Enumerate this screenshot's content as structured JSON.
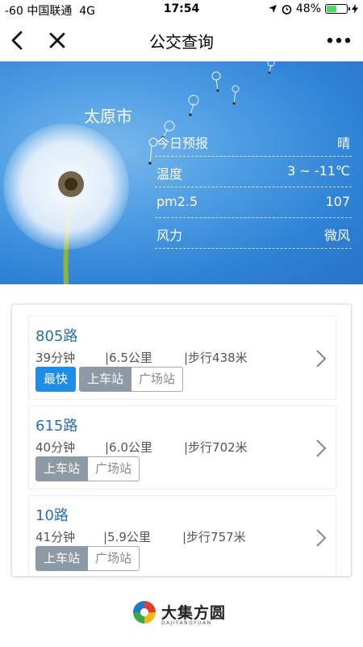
{
  "status_bar": {
    "carrier": "-60 中国联通",
    "network": "4G",
    "time": "17:54",
    "battery_text": "48%",
    "battery_level": 0.48
  },
  "nav": {
    "title": "公交查询",
    "back_icon": "chevron-left-icon",
    "close_icon": "close-icon",
    "more_icon": "more-dots-icon"
  },
  "weather": {
    "city": "太原市",
    "rows": [
      {
        "key": "今日预报",
        "value": "晴"
      },
      {
        "key": "温度",
        "value": "3 ~ -11℃"
      },
      {
        "key": "pm2.5",
        "value": "107"
      },
      {
        "key": "风力",
        "value": "微风"
      }
    ]
  },
  "routes": [
    {
      "name": "805路",
      "duration": "39分钟",
      "distance": "|6.5公里",
      "walk": "|步行438米",
      "fastest": "最快",
      "board": "上车站",
      "stop": "广场站"
    },
    {
      "name": "615路",
      "duration": "40分钟",
      "distance": "|6.0公里",
      "walk": "|步行702米",
      "board": "上车站",
      "stop": "广场站"
    },
    {
      "name": "10路",
      "duration": "41分钟",
      "distance": "|5.9公里",
      "walk": "|步行757米",
      "board": "上车站",
      "stop": "广场站"
    }
  ],
  "footer": {
    "brand": "大集方圆",
    "brand_sub": "DAJIFANGYUAN"
  },
  "colors": {
    "link_blue": "#2a6eb5",
    "tag_blue": "#1f8ce6",
    "tag_gray": "#8e99a6",
    "sky_blue": "#3a8de0"
  }
}
